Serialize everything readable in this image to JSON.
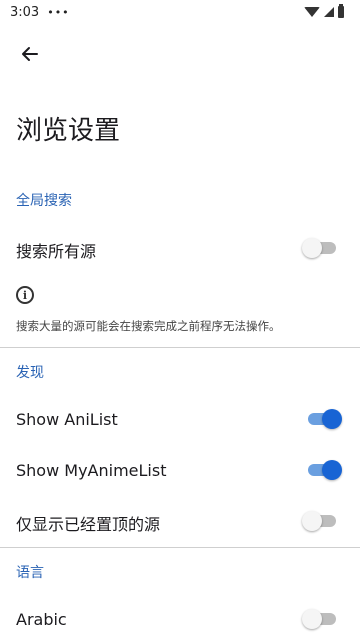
{
  "status_bar": {
    "time": "3:03",
    "more": "•••"
  },
  "page": {
    "title": "浏览设置"
  },
  "sections": {
    "global_search": {
      "header": "全局搜索",
      "search_all_sources": {
        "label": "搜索所有源",
        "on": false
      },
      "info_text": "搜索大量的源可能会在搜索完成之前程序无法操作。"
    },
    "discover": {
      "header": "发现",
      "show_anilist": {
        "label": "Show AniList",
        "on": true
      },
      "show_myanimelist": {
        "label": "Show MyAnimeList",
        "on": true
      },
      "pinned_only": {
        "label": "仅显示已经置顶的源",
        "on": false
      }
    },
    "language": {
      "header": "语言",
      "arabic": {
        "label": "Arabic",
        "on": false
      }
    }
  },
  "colors": {
    "accent": "#1864d4",
    "section_header": "#2a63b4"
  }
}
